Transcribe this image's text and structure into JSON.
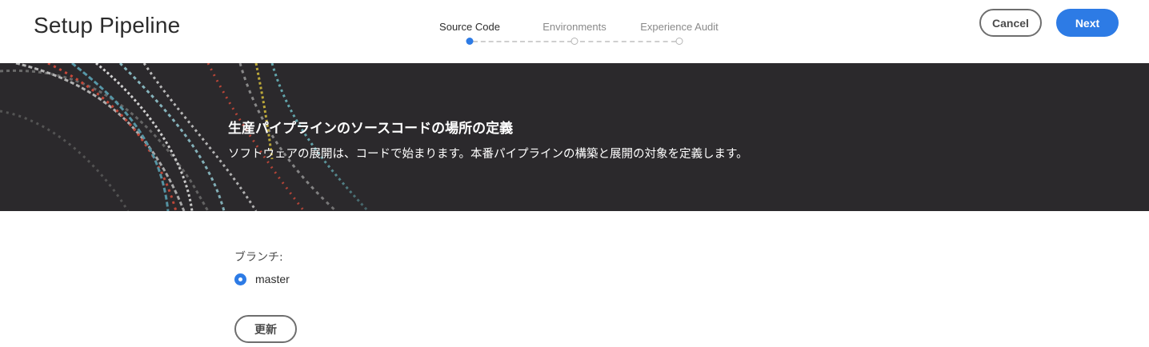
{
  "header": {
    "title": "Setup Pipeline",
    "cancel_label": "Cancel",
    "next_label": "Next"
  },
  "stepper": {
    "steps": [
      {
        "label": "Source Code",
        "state": "active"
      },
      {
        "label": "Environments",
        "state": "inactive"
      },
      {
        "label": "Experience Audit",
        "state": "inactive"
      }
    ]
  },
  "banner": {
    "title": "生産パイプラインのソースコードの場所の定義",
    "description": "ソフトウェアの展開は、コードで始まります。本番パイプラインの構築と展開の対象を定義します。"
  },
  "form": {
    "branch_label": "ブランチ:",
    "branch_options": [
      {
        "label": "master",
        "selected": true
      }
    ],
    "refresh_label": "更新"
  },
  "colors": {
    "accent": "#2d7be5",
    "banner_bg": "#2b292c"
  }
}
